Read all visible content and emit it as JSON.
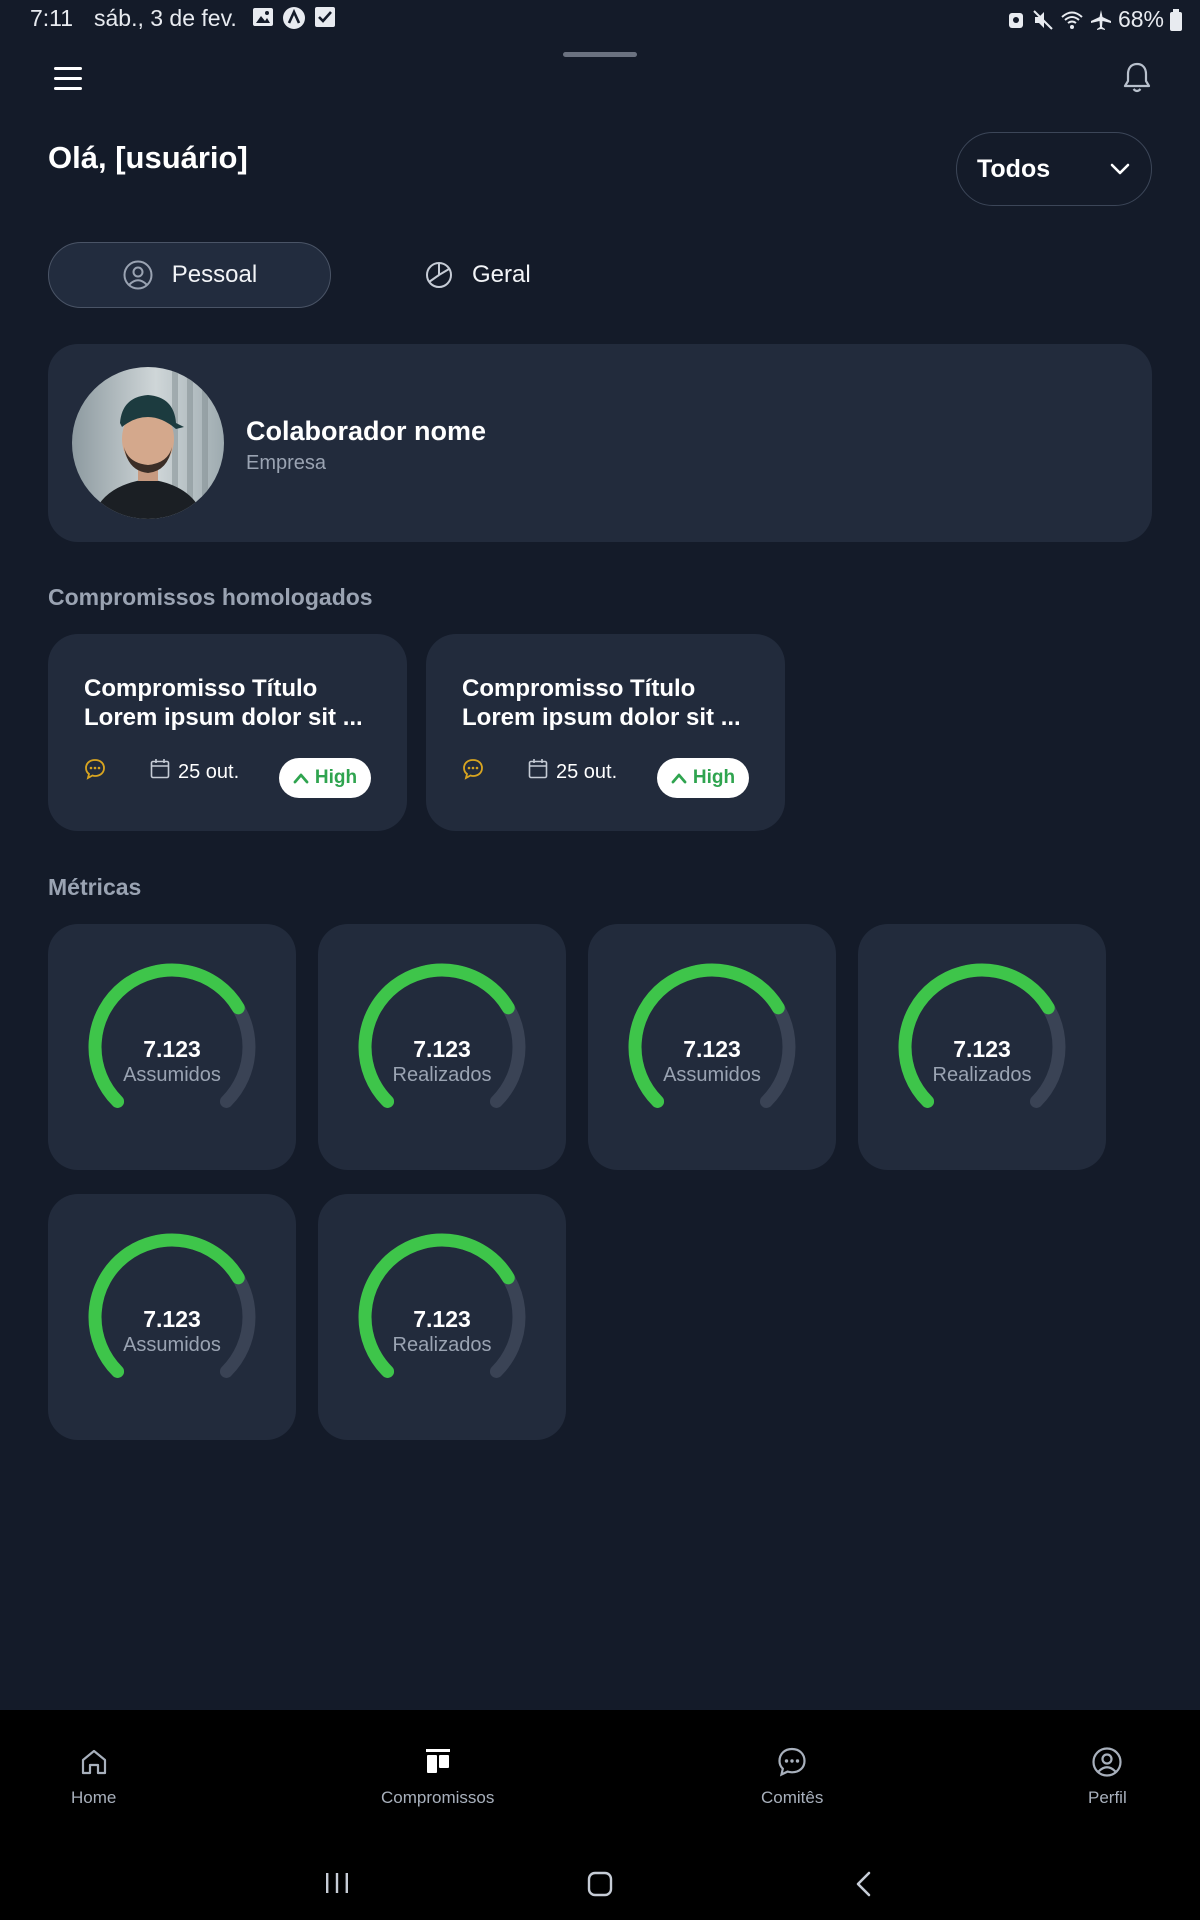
{
  "status_bar": {
    "time": "7:11",
    "date": "sáb., 3 de fev.",
    "battery": "68%"
  },
  "header": {
    "greeting": "Olá, [usuário]",
    "filter_value": "Todos"
  },
  "tabs": [
    {
      "label": "Pessoal",
      "icon": "user-circle-icon",
      "active": true
    },
    {
      "label": "Geral",
      "icon": "pie-chart-icon",
      "active": false
    }
  ],
  "profile": {
    "name": "Colaborador nome",
    "company": "Empresa"
  },
  "commitments": {
    "section_title": "Compromissos homologados",
    "items": [
      {
        "title": "Compromisso Título Lorem ipsum dolor sit ...",
        "date": "25 out.",
        "priority": "High"
      },
      {
        "title": "Compromisso Título Lorem ipsum dolor sit ...",
        "date": "25 out.",
        "priority": "High"
      }
    ]
  },
  "metrics": {
    "section_title": "Métricas",
    "items": [
      {
        "value": "7.123",
        "label": "Assumidos",
        "progress": 0.72
      },
      {
        "value": "7.123",
        "label": "Realizados",
        "progress": 0.72
      },
      {
        "value": "7.123",
        "label": "Assumidos",
        "progress": 0.72
      },
      {
        "value": "7.123",
        "label": "Realizados",
        "progress": 0.72
      },
      {
        "value": "7.123",
        "label": "Assumidos",
        "progress": 0.72
      },
      {
        "value": "7.123",
        "label": "Realizados",
        "progress": 0.72
      }
    ]
  },
  "bottom_nav": [
    {
      "label": "Home",
      "icon": "home-icon"
    },
    {
      "label": "Compromissos",
      "icon": "columns-icon"
    },
    {
      "label": "Comitês",
      "icon": "chat-icon"
    },
    {
      "label": "Perfil",
      "icon": "user-circle-icon"
    }
  ],
  "colors": {
    "background": "#141b29",
    "card": "#222b3c",
    "accent_green": "#3ec54a",
    "track": "#3a4355",
    "priority_green": "#2fa44f",
    "chat_icon": "#d9a520"
  }
}
